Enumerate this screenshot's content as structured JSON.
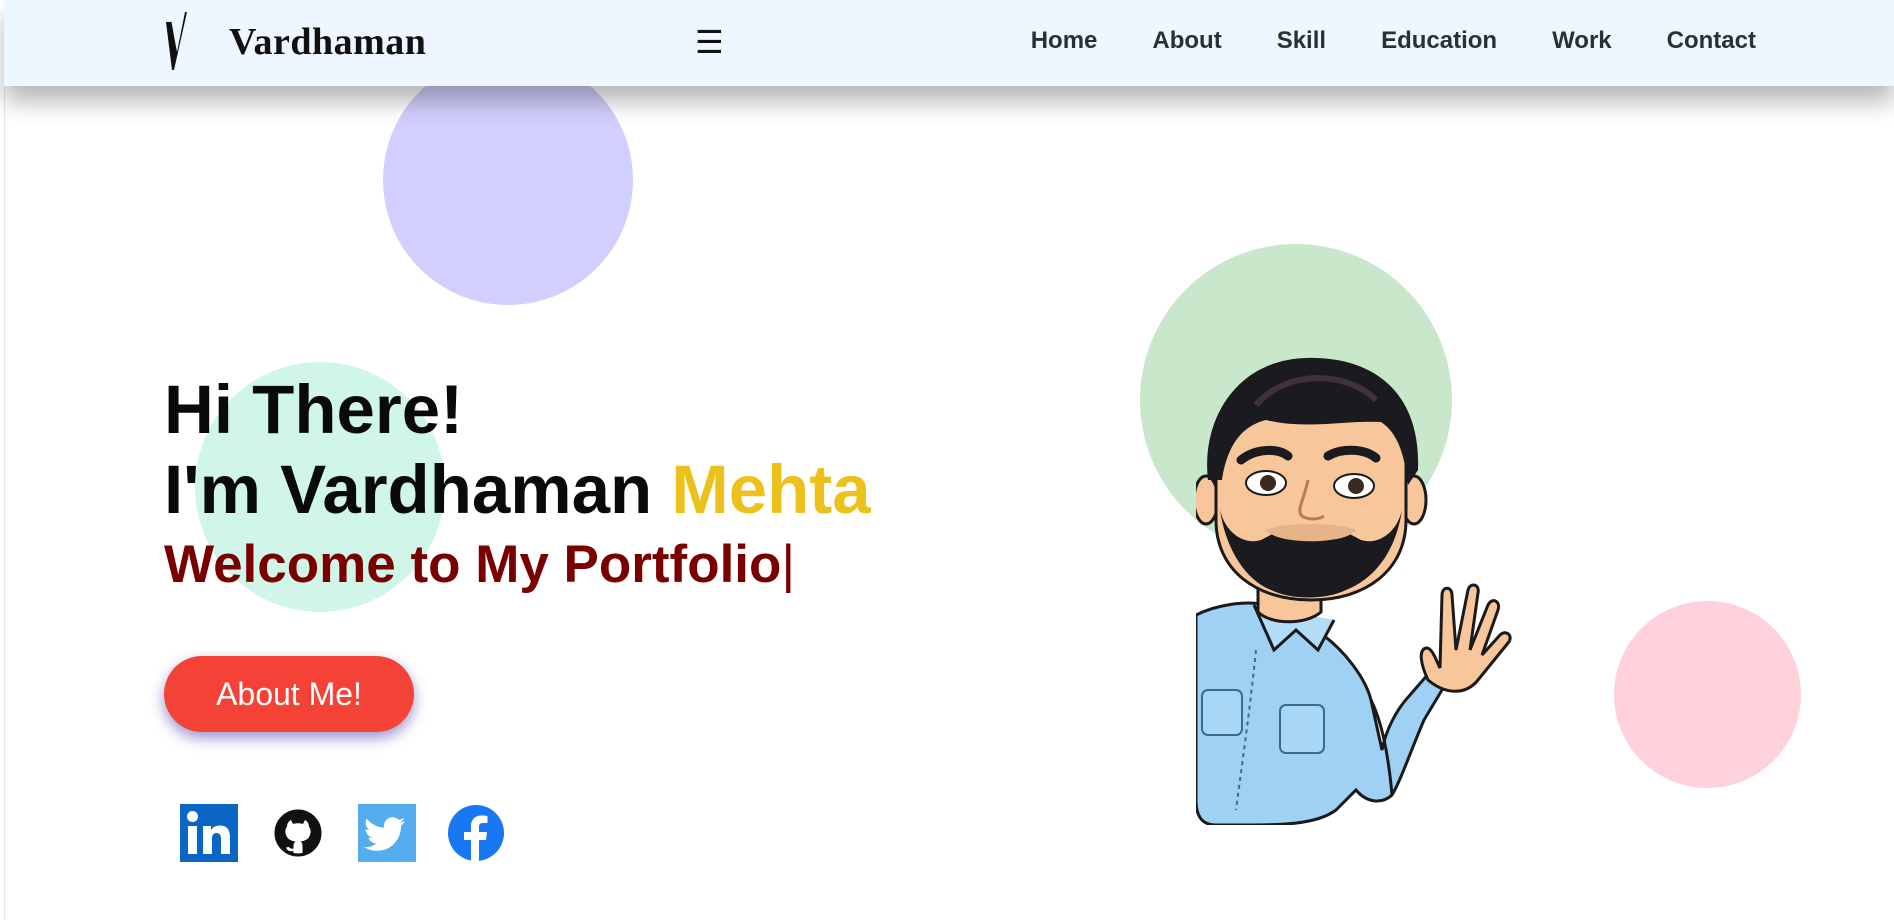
{
  "header": {
    "brand": "Vardhaman",
    "menu_icon": "hamburger-icon",
    "menu_glyph": "☰",
    "nav": [
      {
        "label": "Home"
      },
      {
        "label": "About"
      },
      {
        "label": "Skill"
      },
      {
        "label": "Education"
      },
      {
        "label": "Work"
      },
      {
        "label": "Contact"
      }
    ]
  },
  "hero": {
    "greeting": "Hi There!",
    "intro_prefix": "I'm Vardhaman ",
    "intro_accent": "Mehta",
    "typed_text": "Welcome to My Portfolio",
    "typed_cursor": "|",
    "cta_label": "About Me!"
  },
  "socials": [
    {
      "icon": "linkedin-icon"
    },
    {
      "icon": "github-icon"
    },
    {
      "icon": "twitter-icon"
    },
    {
      "icon": "facebook-icon"
    }
  ],
  "colors": {
    "accent_yellow": "#ecc11c",
    "typed_red": "#7a0000",
    "cta_red": "#f44336",
    "navbar_bg": "#eef6ff"
  }
}
